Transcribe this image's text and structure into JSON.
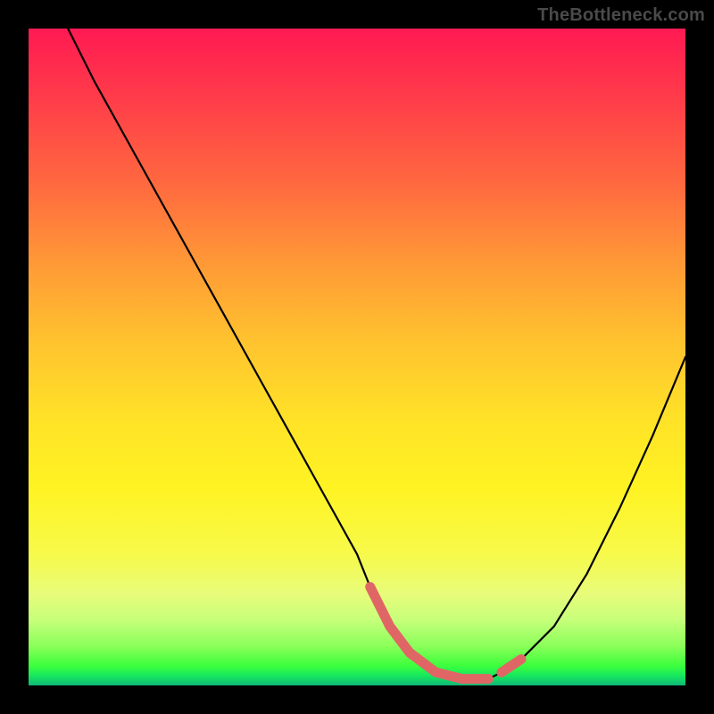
{
  "watermark": "TheBottleneck.com",
  "colors": {
    "frame": "#000000",
    "curve_stroke": "#000000",
    "highlight_stroke": "#e06666",
    "gradient_top": "#ff1a52",
    "gradient_bottom": "#0fb878"
  },
  "chart_data": {
    "type": "line",
    "title": "",
    "xlabel": "",
    "ylabel": "",
    "xlim": [
      0,
      100
    ],
    "ylim": [
      0,
      100
    ],
    "grid": false,
    "legend": false,
    "series": [
      {
        "name": "curve",
        "x": [
          6,
          10,
          15,
          20,
          25,
          30,
          35,
          40,
          45,
          50,
          52,
          55,
          58,
          62,
          66,
          70,
          72,
          75,
          80,
          85,
          90,
          95,
          100
        ],
        "y": [
          100,
          92,
          83,
          74,
          65,
          56,
          47,
          38,
          29,
          20,
          15,
          9,
          5,
          2,
          1,
          1,
          2,
          4,
          9,
          17,
          27,
          38,
          50
        ]
      }
    ],
    "highlight_segments": [
      {
        "x": [
          52,
          55,
          58,
          62,
          66,
          70
        ],
        "y": [
          15,
          9,
          5,
          2,
          1,
          1
        ]
      },
      {
        "x": [
          72,
          75
        ],
        "y": [
          2,
          4
        ]
      }
    ]
  }
}
